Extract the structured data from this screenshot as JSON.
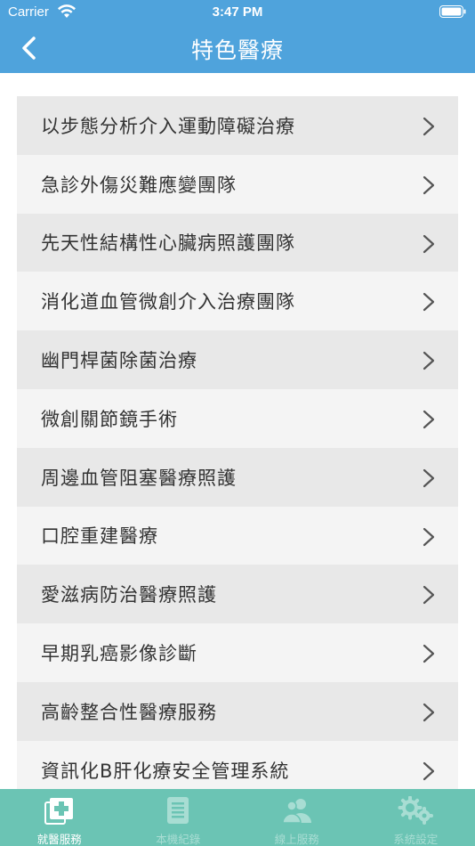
{
  "status_bar": {
    "carrier": "Carrier",
    "time": "3:47 PM"
  },
  "nav": {
    "title": "特色醫療",
    "back_icon": "chevron-left-icon"
  },
  "list": {
    "items": [
      {
        "label": "以步態分析介入運動障礙治療"
      },
      {
        "label": "急診外傷災難應變團隊"
      },
      {
        "label": "先天性結構性心臟病照護團隊"
      },
      {
        "label": "消化道血管微創介入治療團隊"
      },
      {
        "label": "幽門桿菌除菌治療"
      },
      {
        "label": "微創關節鏡手術"
      },
      {
        "label": "周邊血管阻塞醫療照護"
      },
      {
        "label": "口腔重建醫療"
      },
      {
        "label": "愛滋病防治醫療照護"
      },
      {
        "label": "早期乳癌影像診斷"
      },
      {
        "label": "高齡整合性醫療服務"
      },
      {
        "label": "資訊化B肝化療安全管理系統"
      }
    ]
  },
  "tabs": [
    {
      "label": "就醫服務",
      "icon": "medical-cross-icon",
      "active": true
    },
    {
      "label": "本機紀錄",
      "icon": "document-record-icon",
      "active": false
    },
    {
      "label": "線上服務",
      "icon": "users-icon",
      "active": false
    },
    {
      "label": "系統設定",
      "icon": "gear-icon",
      "active": false
    }
  ],
  "colors": {
    "header": "#4fa3dc",
    "tab_bar": "#6bc4b4",
    "row_odd": "#e8e8e8",
    "row_even": "#f4f4f4"
  }
}
